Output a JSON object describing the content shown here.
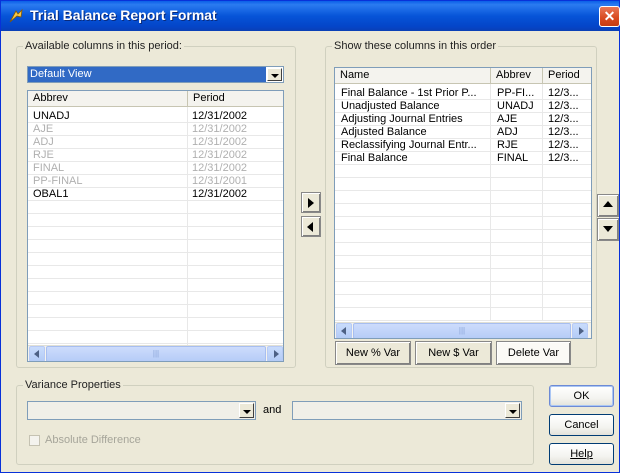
{
  "window": {
    "title": "Trial Balance Report Format",
    "close_label": "✕"
  },
  "available": {
    "legend": "Available columns in this period:",
    "view_selected": "Default View",
    "headers": [
      "Abbrev",
      "Period"
    ],
    "rows": [
      {
        "abbrev": "UNADJ",
        "period": "12/31/2002",
        "enabled": true
      },
      {
        "abbrev": "AJE",
        "period": "12/31/2002",
        "enabled": false
      },
      {
        "abbrev": "ADJ",
        "period": "12/31/2002",
        "enabled": false
      },
      {
        "abbrev": "RJE",
        "period": "12/31/2002",
        "enabled": false
      },
      {
        "abbrev": "FINAL",
        "period": "12/31/2002",
        "enabled": false
      },
      {
        "abbrev": "PP-FINAL",
        "period": "12/31/2001",
        "enabled": false
      },
      {
        "abbrev": "OBAL1",
        "period": "12/31/2002",
        "enabled": true
      }
    ]
  },
  "shown": {
    "legend": "Show these columns in this order",
    "headers": [
      "Name",
      "Abbrev",
      "Period"
    ],
    "rows": [
      {
        "name": "Final Balance - 1st Prior P...",
        "abbrev": "PP-FI...",
        "period": "12/3..."
      },
      {
        "name": "Unadjusted Balance",
        "abbrev": "UNADJ",
        "period": "12/3..."
      },
      {
        "name": "Adjusting Journal Entries",
        "abbrev": "AJE",
        "period": "12/3..."
      },
      {
        "name": "Adjusted Balance",
        "abbrev": "ADJ",
        "period": "12/3..."
      },
      {
        "name": "Reclassifying Journal Entr...",
        "abbrev": "RJE",
        "period": "12/3..."
      },
      {
        "name": "Final Balance",
        "abbrev": "FINAL",
        "period": "12/3..."
      }
    ],
    "buttons": {
      "new_pct": "New % Var",
      "new_dollar": "New $ Var",
      "delete": "Delete Var"
    }
  },
  "variance": {
    "legend": "Variance Properties",
    "and_label": "and",
    "abs_diff_label": "Absolute Difference"
  },
  "actions": {
    "ok": "OK",
    "cancel": "Cancel",
    "help": "Help"
  },
  "colors": {
    "title_bar": "#0654d8",
    "selection": "#316ac5",
    "dialog_bg": "#ece9d8"
  }
}
